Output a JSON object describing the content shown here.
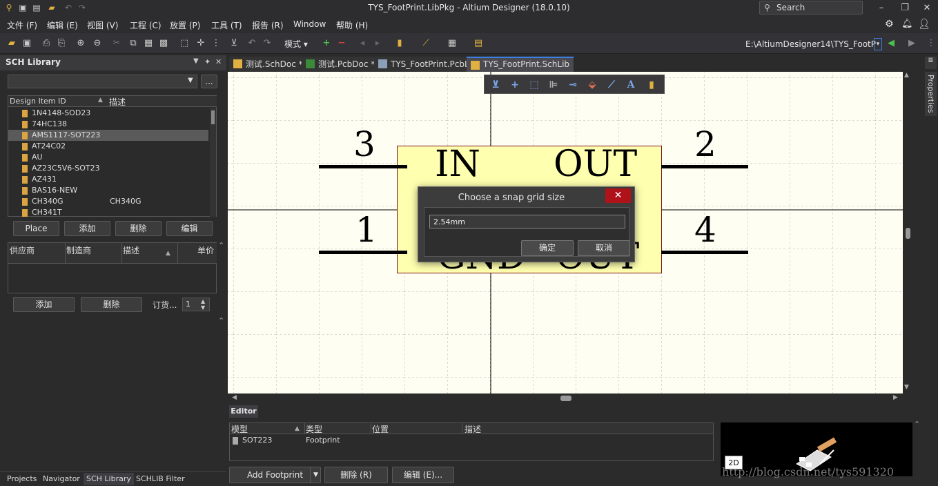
{
  "window": {
    "title": "TYS_FootPrint.LibPkg - Altium Designer (18.0.10)",
    "search_placeholder": "Search"
  },
  "menu": [
    "文件 (F)",
    "编辑 (E)",
    "视图 (V)",
    "工程 (C)",
    "放置 (P)",
    "工具 (T)",
    "报告 (R)",
    "Window",
    "帮助 (H)"
  ],
  "toolbar": {
    "mode_label": "模式",
    "path": "E:\\AltiumDesigner14\\TYS_FootP"
  },
  "left_panel": {
    "title": "SCH Library",
    "col_id": "Design Item ID",
    "col_desc": "描述",
    "items": [
      {
        "id": "1N4148-SOD23",
        "desc": ""
      },
      {
        "id": "74HC138",
        "desc": ""
      },
      {
        "id": "AMS1117-SOT223",
        "desc": ""
      },
      {
        "id": "AT24C02",
        "desc": ""
      },
      {
        "id": "AU",
        "desc": ""
      },
      {
        "id": "AZ23C5V6-SOT23",
        "desc": ""
      },
      {
        "id": "AZ431",
        "desc": ""
      },
      {
        "id": "BAS16-NEW",
        "desc": ""
      },
      {
        "id": "CH340G",
        "desc": "CH340G"
      },
      {
        "id": "CH341T",
        "desc": ""
      }
    ],
    "selected_index": 2,
    "buttons": {
      "place": "Place",
      "add": "添加",
      "delete": "删除",
      "edit": "编辑"
    },
    "supplier_cols": [
      "供应商",
      "制造商",
      "描述",
      "单价"
    ],
    "supplier_buttons": {
      "add": "添加",
      "delete": "删除"
    },
    "order_label": "订货...",
    "order_qty": "1",
    "more_btn": "..."
  },
  "bottom_tabs": [
    "Projects",
    "Navigator",
    "SCH Library",
    "SCHLIB Filter"
  ],
  "active_bottom_tab": 2,
  "doc_tabs": [
    {
      "label": "测试.SchDoc *",
      "active": false
    },
    {
      "label": "测试.PcbDoc *",
      "active": false
    },
    {
      "label": "TYS_FootPrint.PcbLib",
      "active": false
    },
    {
      "label": "TYS_FootPrint.SchLib",
      "active": true
    }
  ],
  "component": {
    "pins": [
      {
        "num": "3",
        "name": "IN"
      },
      {
        "num": "2",
        "name": "OUT"
      },
      {
        "num": "1",
        "name": "GND"
      },
      {
        "num": "4",
        "name": "OUT"
      }
    ]
  },
  "dialog": {
    "title": "Choose a snap grid size",
    "value": "2.54mm",
    "ok": "确定",
    "cancel": "取消",
    "close": "✕"
  },
  "editor": {
    "tab": "Editor",
    "cols": [
      "模型",
      "类型",
      "位置",
      "描述"
    ],
    "rows": [
      {
        "model": "SOT223",
        "type": "Footprint"
      }
    ],
    "buttons": {
      "add_footprint": "Add Footprint",
      "delete": "删除 (R)",
      "edit": "编辑 (E)..."
    },
    "view_mode": "2D"
  },
  "right_strip": {
    "properties": "Properties"
  },
  "watermark": "http://blog.csdn.net/tys591320",
  "colors": {
    "canvas": "#fffef2",
    "component_fill": "#ffffb0",
    "close_red": "#b0121a",
    "accent": "#3d7fe0"
  }
}
